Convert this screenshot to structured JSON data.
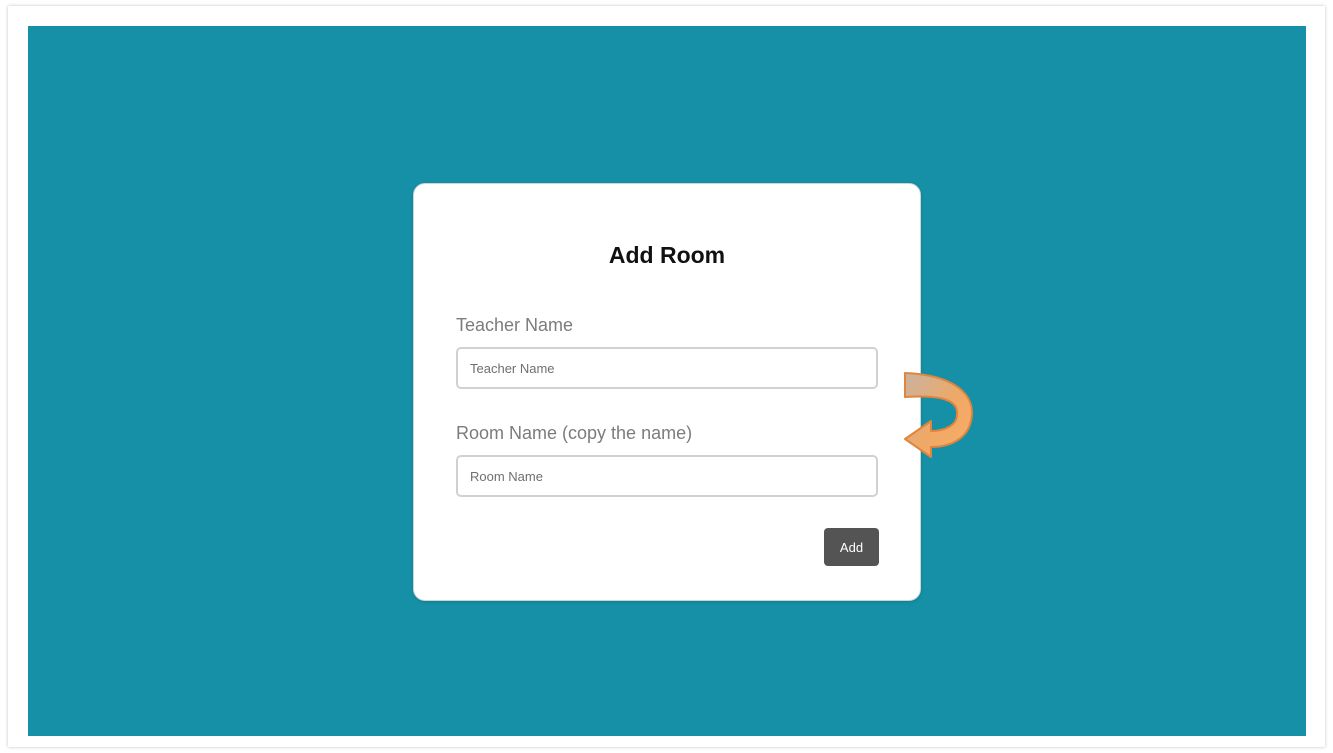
{
  "form": {
    "title": "Add Room",
    "teacher_label": "Teacher Name",
    "teacher_placeholder": "Teacher Name",
    "teacher_value": "",
    "room_label": "Room Name (copy the name)",
    "room_placeholder": "Room Name",
    "room_value": "",
    "add_label": "Add"
  },
  "colors": {
    "background": "#1690a6",
    "card": "#ffffff",
    "button": "#545454",
    "arrow": "#f4a25a"
  },
  "icons": {
    "annotation": "curved-arrow-icon"
  }
}
